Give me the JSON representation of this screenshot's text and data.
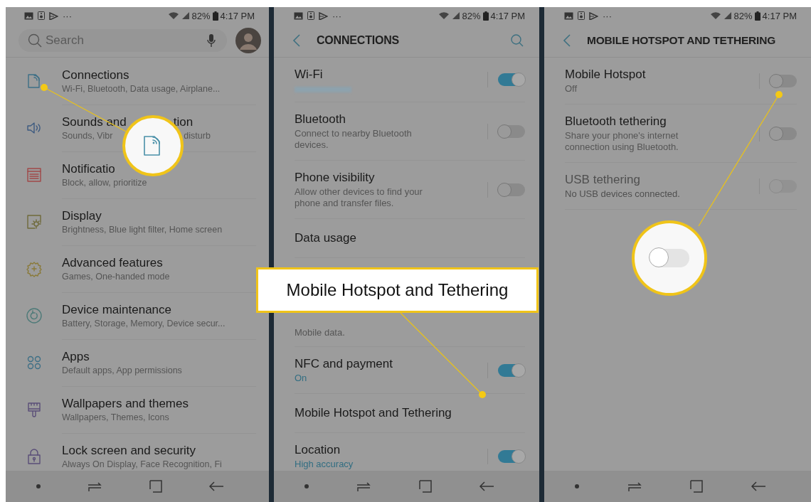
{
  "panels": [
    {
      "kind": "home",
      "status_bar": {
        "more": "···",
        "battery": "82%",
        "time": "4:17 PM"
      },
      "search": {
        "placeholder": "Search"
      },
      "items": [
        {
          "title": "Connections",
          "subtitle": "Wi-Fi, Bluetooth, Data usage, Airplane..."
        },
        {
          "title": "Sounds and",
          "title_after_callout": "tion",
          "subtitle": "Sounds, Vibr",
          "subtitle_after_callout": "disturb"
        },
        {
          "title": "Notificatio",
          "subtitle": "Block, allow, prioritize"
        },
        {
          "title": "Display",
          "subtitle": "Brightness, Blue light filter, Home screen"
        },
        {
          "title": "Advanced features",
          "subtitle": "Games, One-handed mode"
        },
        {
          "title": "Device maintenance",
          "subtitle": "Battery, Storage, Memory, Device secur..."
        },
        {
          "title": "Apps",
          "subtitle": "Default apps, App permissions"
        },
        {
          "title": "Wallpapers and themes",
          "subtitle": "Wallpapers, Themes, Icons"
        },
        {
          "title": "Lock screen and security",
          "subtitle": "Always On Display, Face Recognition, Fi"
        }
      ],
      "callout": {
        "kind": "icon-magnifier"
      }
    },
    {
      "kind": "sub",
      "status_bar": {
        "more": "···",
        "battery": "82%",
        "time": "4:17 PM"
      },
      "title": "CONNECTIONS",
      "items": [
        {
          "title": "Wi-Fi",
          "kind": "redacted",
          "on": true
        },
        {
          "title": "Bluetooth",
          "subtitle": "Connect to nearby Bluetooth devices.",
          "kind": "plain",
          "on": false
        },
        {
          "title": "Phone visibility",
          "subtitle": "Allow other devices to find your phone and transfer files.",
          "kind": "plain",
          "on": false
        },
        {
          "title": "Data usage",
          "kind": "plain"
        },
        {
          "subtitle": "Mobile data.",
          "kind": "covered"
        },
        {
          "title": "NFC and payment",
          "subtitle": "On",
          "kind": "status",
          "on": true
        },
        {
          "title": "Mobile Hotspot and Tethering",
          "kind": "plain"
        },
        {
          "title": "Location",
          "subtitle": "High accuracy",
          "kind": "status",
          "on": true
        }
      ],
      "callout": {
        "kind": "label",
        "text": "Mobile Hotspot and Tethering"
      }
    },
    {
      "kind": "sub",
      "status_bar": {
        "more": "···",
        "battery": "82%",
        "time": "4:17 PM"
      },
      "title": "MOBILE HOTSPOT AND TETHERING",
      "items": [
        {
          "title": "Mobile Hotspot",
          "subtitle": "Off",
          "kind": "plain",
          "on": false,
          "disabled": false
        },
        {
          "title": "Bluetooth tethering",
          "subtitle": "Share your phone's internet connection using Bluetooth.",
          "kind": "plain",
          "on": false,
          "disabled": false
        },
        {
          "title": "USB tethering",
          "subtitle": "No USB devices connected.",
          "kind": "plain",
          "on": false,
          "disabled": true
        }
      ],
      "callout": {
        "kind": "toggle-magnifier",
        "on": false
      }
    }
  ]
}
